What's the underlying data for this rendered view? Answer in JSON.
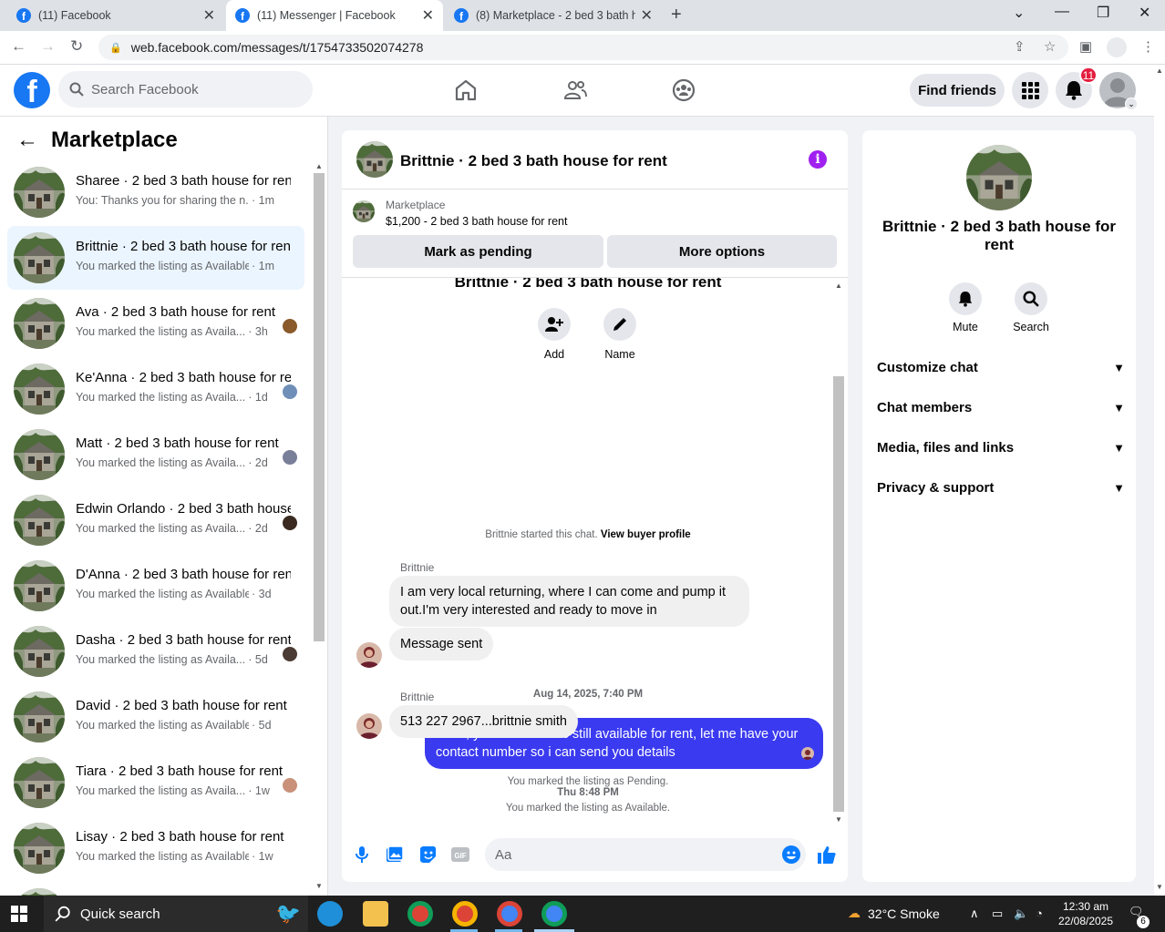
{
  "browser": {
    "tabs": [
      {
        "label": "(11) Facebook",
        "active": false
      },
      {
        "label": "(11) Messenger | Facebook",
        "active": true
      },
      {
        "label": "(8) Marketplace - 2 bed 3 bath ho",
        "active": false
      }
    ],
    "url": "web.facebook.com/messages/t/1754733502074278"
  },
  "fb": {
    "search_placeholder": "Search Facebook",
    "find_friends": "Find friends",
    "notif_count": "11"
  },
  "sidebar": {
    "title": "Marketplace",
    "conversations": [
      {
        "name": "Sharee · 2 bed 3 bath house for rent",
        "snippet": "You: Thanks you for sharing the n...",
        "time": "· 1m",
        "active": false,
        "mini_color": ""
      },
      {
        "name": "Brittnie · 2 bed 3 bath house for rent",
        "snippet": "You marked the listing as Available.",
        "time": "· 1m",
        "active": true,
        "mini_color": ""
      },
      {
        "name": "Ava · 2 bed 3 bath house for rent",
        "snippet": "You marked the listing as Availa...",
        "time": "· 3h",
        "active": false,
        "mini_color": "#8a5a2b"
      },
      {
        "name": "Ke'Anna · 2 bed 3 bath house for rent",
        "snippet": "You marked the listing as Availa...",
        "time": "· 1d",
        "active": false,
        "mini_color": "#6f8fb8"
      },
      {
        "name": "Matt · 2 bed 3 bath house for rent",
        "snippet": "You marked the listing as Availa...",
        "time": "· 2d",
        "active": false,
        "mini_color": "#7a7f99"
      },
      {
        "name": "Edwin Orlando · 2 bed 3 bath house for rent",
        "snippet": "You marked the listing as Availa...",
        "time": "· 2d",
        "active": false,
        "mini_color": "#3a2a1f"
      },
      {
        "name": "D'Anna · 2 bed 3 bath house for rent",
        "snippet": "You marked the listing as Available.",
        "time": "· 3d",
        "active": false,
        "mini_color": ""
      },
      {
        "name": "Dasha · 2 bed 3 bath house for rent",
        "snippet": "You marked the listing as Availa...",
        "time": "· 5d",
        "active": false,
        "mini_color": "#4b3b35"
      },
      {
        "name": "David · 2 bed 3 bath house for rent",
        "snippet": "You marked the listing as Available.",
        "time": "· 5d",
        "active": false,
        "mini_color": ""
      },
      {
        "name": "Tiara · 2 bed 3 bath house for rent",
        "snippet": "You marked the listing as Availa...",
        "time": "· 1w",
        "active": false,
        "mini_color": "#c9907a"
      },
      {
        "name": "Lisay · 2 bed 3 bath house for rent",
        "snippet": "You marked the listing as Available.",
        "time": "· 1w",
        "active": false,
        "mini_color": ""
      }
    ]
  },
  "chat": {
    "title": "Brittnie · 2 bed 3 bath house for rent",
    "listing_source": "Marketplace",
    "listing_price": "$1,200 - 2 bed 3 bath house for rent",
    "mark_pending": "Mark as pending",
    "more_options": "More options",
    "add_label": "Add",
    "name_label": "Name",
    "started_text": "Brittnie started this chat.",
    "view_profile": "View buyer profile",
    "sender1": "Brittnie",
    "msg1": "I am very local returning, where I can come and pump it out.I'm very interested and ready to move in",
    "msg2": "Message sent",
    "ts1": "Aug 14, 2025, 7:40 PM",
    "my_msg": "Hello, yes the house is still available for rent, let me have your contact number so i can send you  details",
    "ts2": "Thu 8:48 PM",
    "sender2": "Brittnie",
    "msg3": "513 227 2967...brittnie smith",
    "sys_pending": "You marked the listing as Pending.",
    "sys_available": "You marked the listing as Available.",
    "input_placeholder": "Aa"
  },
  "right_panel": {
    "title": "Brittnie · 2 bed 3 bath house for rent",
    "mute": "Mute",
    "search": "Search",
    "rows": [
      "Customize chat",
      "Chat members",
      "Media, files and links",
      "Privacy & support"
    ]
  },
  "taskbar": {
    "search": "Quick search",
    "weather": "32°C  Smoke",
    "time": "12:30 am",
    "date": "22/08/2025",
    "notif": "6"
  }
}
